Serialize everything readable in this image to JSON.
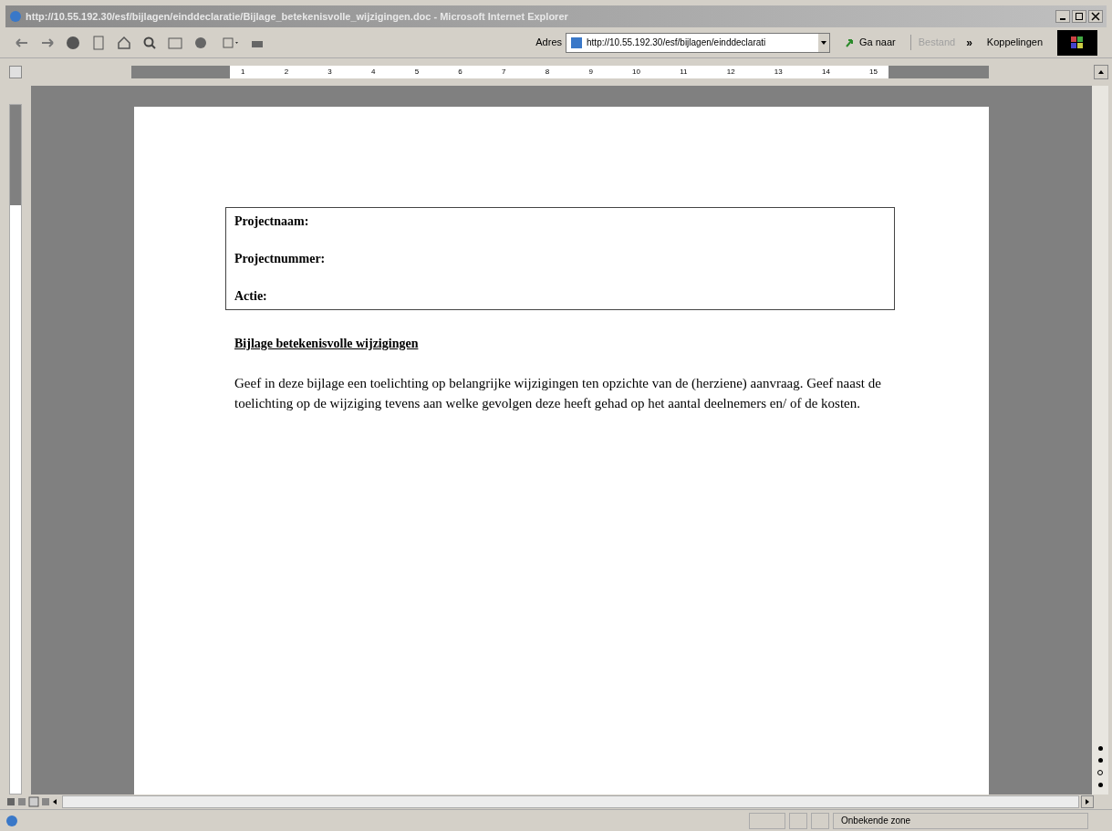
{
  "window": {
    "title": "http://10.55.192.30/esf/bijlagen/einddeclaratie/Bijlage_betekenisvolle_wijzigingen.doc - Microsoft Internet Explorer"
  },
  "toolbar": {
    "address_label": "Adres",
    "address": "http://10.55.192.30/esf/bijlagen/einddeclarati",
    "go_button": "Ga naar",
    "menu_button": {
      "label": "Bestand",
      "disabled": true
    },
    "more": "»",
    "links": "Koppelingen"
  },
  "ruler": {
    "numbers": [
      "1",
      "2",
      "3",
      "4",
      "5",
      "6",
      "7",
      "8",
      "9",
      "10",
      "11",
      "12",
      "13",
      "14",
      "15"
    ]
  },
  "document": {
    "fields": [
      "Projectnaam:",
      "Projectnummer:",
      "Actie:"
    ],
    "heading": "Bijlage betekenisvolle wijzigingen",
    "paragraph": "Geef in deze bijlage een toelichting op belangrijke wijzigingen ten opzichte van de (herziene) aanvraag. Geef naast de toelichting op de wijziging tevens aan welke gevolgen deze heeft gehad op het aantal deelnemers en/ of de kosten."
  },
  "status_bar": {
    "zone": "Onbekende zone"
  }
}
